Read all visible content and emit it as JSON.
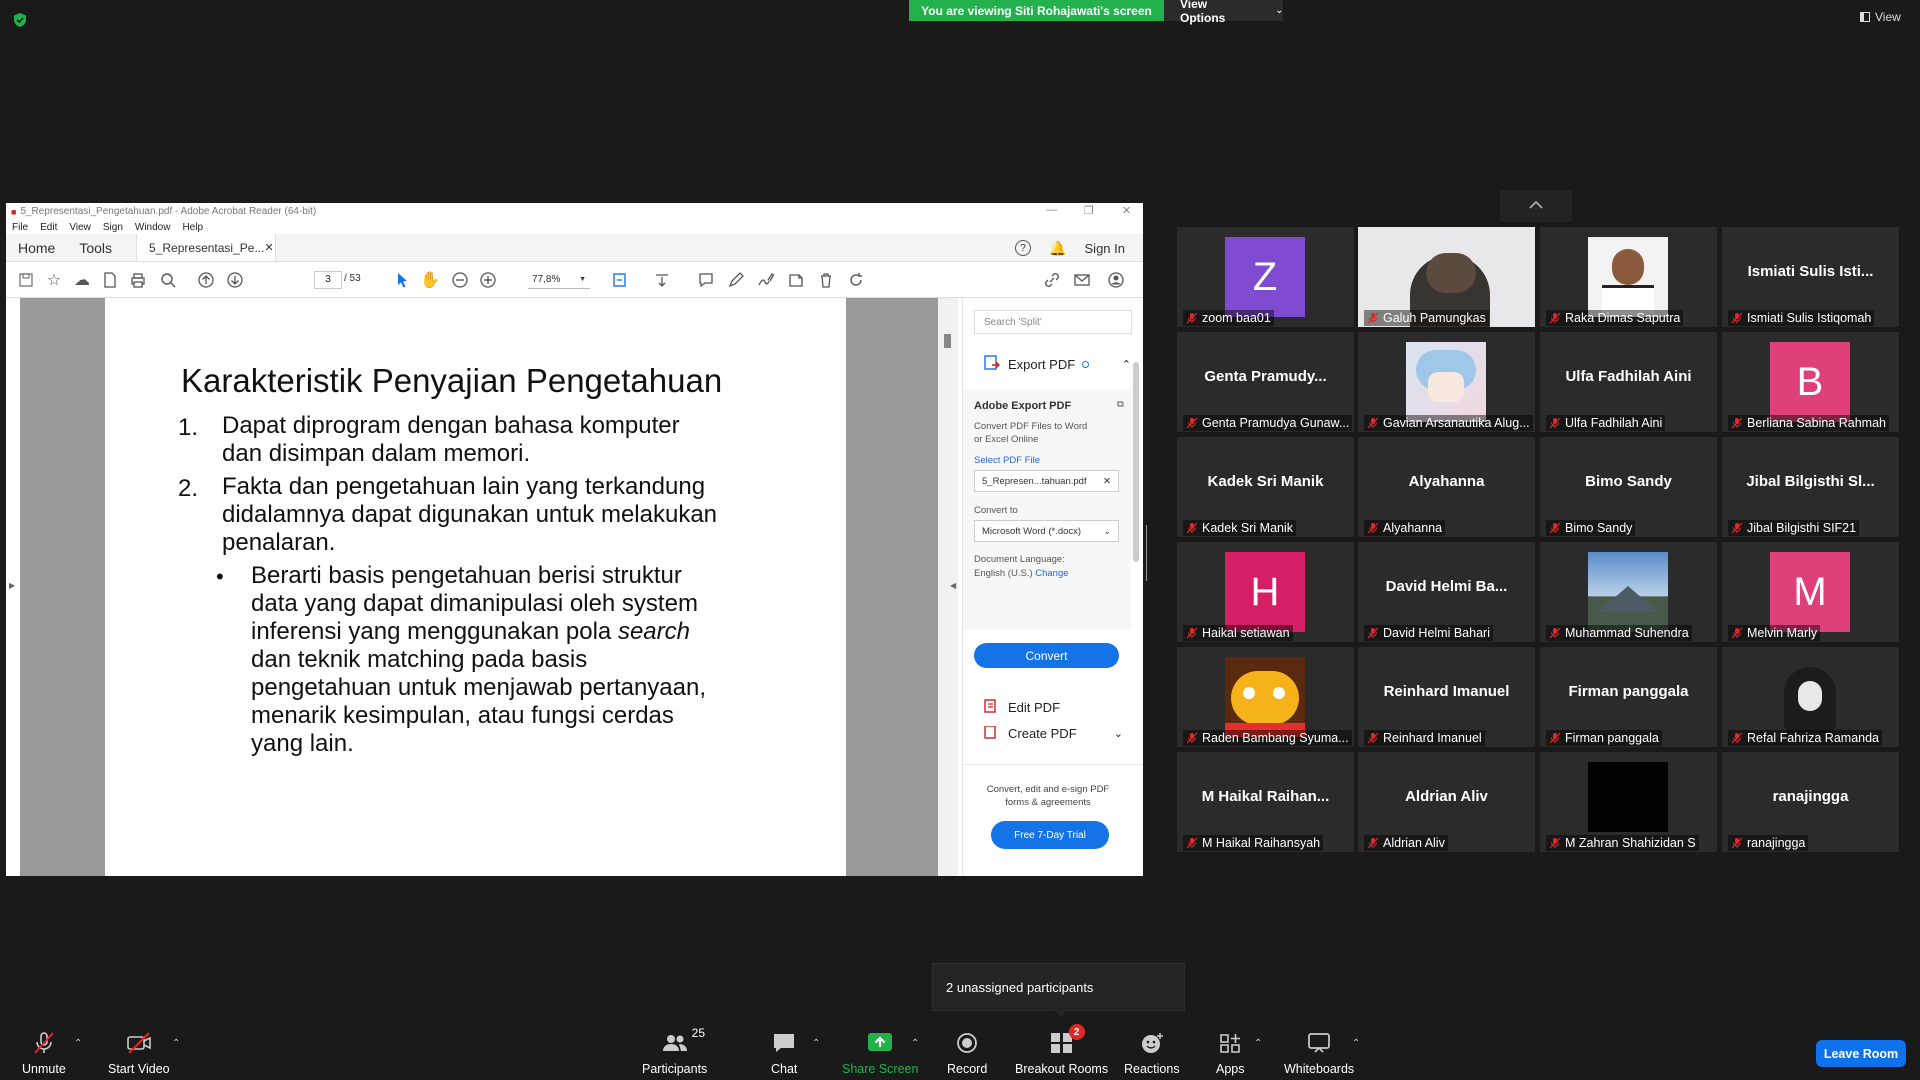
{
  "top": {
    "banner": "You are viewing Siti Rohajawati's screen",
    "view_options": "View Options",
    "view": "View"
  },
  "acrobat": {
    "title": "5_Representasi_Pengetahuan.pdf - Adobe Acrobat Reader (64-bit)",
    "menu": [
      "File",
      "Edit",
      "View",
      "Sign",
      "Window",
      "Help"
    ],
    "tabs": {
      "home": "Home",
      "tools": "Tools",
      "doc": "5_Representasi_Pe...",
      "sign_in": "Sign In"
    },
    "toolbar": {
      "page_current": "3",
      "page_total": "/ 53",
      "zoom": "77,8%"
    },
    "slide": {
      "title": "Karakteristik Penyajian Pengetahuan",
      "item1_num": "1.",
      "item1_lines": [
        "Dapat diprogram dengan bahasa komputer",
        "dan disimpan dalam memori."
      ],
      "item2_num": "2.",
      "item2_lines": [
        "Fakta dan pengetahuan lain yang terkandung",
        "didalamnya dapat digunakan untuk melakukan",
        "penalaran."
      ],
      "bullet": "•",
      "bullet_line1": "Berarti basis pengetahuan berisi struktur",
      "bullet_line2": "data yang dapat dimanipulasi oleh system",
      "bullet_line3_a": "inferensi yang menggunakan pola ",
      "bullet_line3_b": "search",
      "bullet_lines_rest": [
        "dan teknik matching pada basis",
        "pengetahuan untuk menjawab pertanyaan,",
        "menarik kesimpulan, atau fungsi cerdas",
        "yang lain."
      ]
    },
    "panel": {
      "search_placeholder": "Search 'Split'",
      "export_pdf": "Export PDF",
      "card_title": "Adobe Export PDF",
      "card_desc_1": "Convert PDF Files to Word",
      "card_desc_2": "or Excel Online",
      "select_pdf": "Select PDF File",
      "file_name": "5_Represen...tahuan.pdf",
      "convert_to": "Convert to",
      "format": "Microsoft Word (*.docx)",
      "doc_lang": "Document Language:",
      "lang": "English (U.S.)",
      "change": "Change",
      "convert": "Convert",
      "edit_pdf": "Edit PDF",
      "create_pdf": "Create PDF",
      "footer_1": "Convert, edit and e-sign PDF",
      "footer_2": "forms & agreements",
      "trial": "Free 7-Day Trial"
    }
  },
  "participants": [
    {
      "name": "zoom baa01",
      "avatar": "Z",
      "avatar_color": "#7f4bd1"
    },
    {
      "name": "Galuh Pamungkas",
      "video": "webcam"
    },
    {
      "name": "Raka Dimas Saputra",
      "video": "photo"
    },
    {
      "name": "Ismiati Sulis Istiqomah",
      "big": "Ismiati Sulis Isti..."
    },
    {
      "name": "Genta Pramudya Gunaw...",
      "big": "Genta Pramudy..."
    },
    {
      "name": "Gavian Arsanautika Alug...",
      "video": "anime"
    },
    {
      "name": "Ulfa Fadhilah Aini",
      "big": "Ulfa Fadhilah Aini"
    },
    {
      "name": "Berliana Sabina Rahmah",
      "avatar": "B",
      "avatar_color": "#e0407a"
    },
    {
      "name": "Kadek Sri Manik",
      "big": "Kadek Sri Manik"
    },
    {
      "name": "Alyahanna",
      "big": "Alyahanna"
    },
    {
      "name": "Bimo Sandy",
      "big": "Bimo Sandy"
    },
    {
      "name": "Jibal Bilgisthi SIF21",
      "big": "Jibal Bilgisthi Sl..."
    },
    {
      "name": "Haikal setiawan",
      "avatar": "H",
      "avatar_color": "#d51e63"
    },
    {
      "name": "David Helmi Bahari",
      "big": "David Helmi Ba..."
    },
    {
      "name": "Muhammad Suhendra",
      "video": "mountain"
    },
    {
      "name": "Melvin Marly",
      "avatar": "M",
      "avatar_color": "#e0407a"
    },
    {
      "name": "Raden Bambang Syuma...",
      "video": "jake"
    },
    {
      "name": "Reinhard Imanuel",
      "big": "Reinhard Imanuel"
    },
    {
      "name": "Firman panggala",
      "big": "Firman panggala"
    },
    {
      "name": "Refal Fahriza Ramanda",
      "video": "wolf"
    },
    {
      "name": "M Haikal Raihansyah",
      "big": "M  Haikal  Raihan..."
    },
    {
      "name": "Aldrian Aliv",
      "big": "Aldrian Aliv"
    },
    {
      "name": "M Zahran Shahizidan S",
      "video": "black"
    },
    {
      "name": "ranajingga",
      "big": "ranajingga"
    }
  ],
  "popup": {
    "unassigned": "2 unassigned participants"
  },
  "toolbar": {
    "unmute": "Unmute",
    "start_video": "Start Video",
    "participants": "Participants",
    "participants_count": "25",
    "chat": "Chat",
    "share_screen": "Share Screen",
    "record": "Record",
    "breakout": "Breakout Rooms",
    "breakout_badge": "2",
    "reactions": "Reactions",
    "apps": "Apps",
    "whiteboards": "Whiteboards",
    "leave": "Leave Room"
  },
  "colors": {
    "banner": "#22b14c",
    "leave": "#0e72ed",
    "share_icon": "#22b14c",
    "muted_red": "#e02828"
  }
}
